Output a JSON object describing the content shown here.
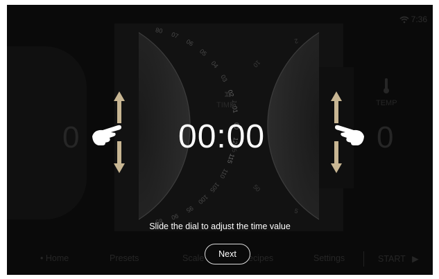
{
  "status": {
    "time": "7:36",
    "wifi_icon": "wifi-icon"
  },
  "left_display": {
    "value": "0"
  },
  "right_display": {
    "value": "0",
    "label": "TEMP",
    "icon": "thermometer-icon"
  },
  "timer": {
    "value": "00:00",
    "label": "TIME",
    "icon": "hourglass-icon"
  },
  "dial_left": {
    "ticks": [
      "80",
      "07",
      "06",
      "05",
      "04",
      "03",
      "02",
      "01",
      "00",
      "120",
      "115",
      "110",
      "105",
      "100",
      "95",
      "90",
      "85"
    ]
  },
  "dial_right": {
    "ticks": [
      "2",
      "10",
      "15",
      "55",
      "50",
      "5"
    ]
  },
  "hint": {
    "text": "Slide the dial to adjust the time value"
  },
  "next_button": {
    "label": "Next"
  },
  "nav": {
    "items": [
      "• Home",
      "Presets",
      "Scale",
      "Recipes",
      "Settings"
    ],
    "start_label": "START"
  },
  "colors": {
    "background": "#0a0a0a",
    "accent_arrow": "#c8b693",
    "text": "#ffffff"
  }
}
